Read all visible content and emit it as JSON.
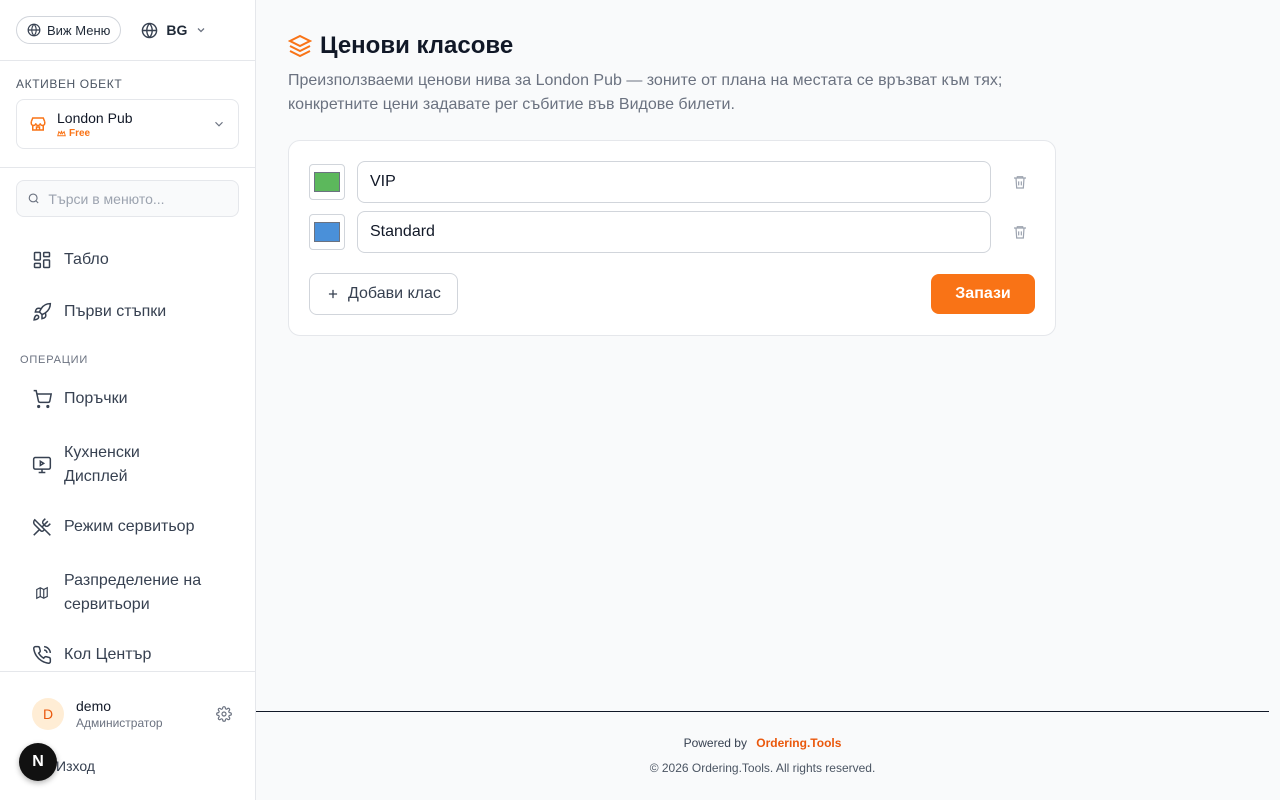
{
  "topbar": {
    "view_menu_label": "Виж Меню",
    "language_code": "BG"
  },
  "venue": {
    "section_label": "АКТИВЕН ОБЕКТ",
    "name": "London Pub",
    "plan": "Free"
  },
  "search": {
    "placeholder": "Търси в менюто..."
  },
  "nav": {
    "items_top": [
      {
        "label": "Табло",
        "icon": "dashboard-icon"
      },
      {
        "label": "Първи стъпки",
        "icon": "rocket-icon"
      }
    ],
    "group_operations": "ОПЕРАЦИИ",
    "items_operations": [
      {
        "label": "Поръчки",
        "icon": "cart-icon"
      },
      {
        "label": "Кухненски Дисплей",
        "icon": "monitor-play-icon"
      },
      {
        "label": "Режим сервитьор",
        "icon": "utensils-crossed-icon"
      },
      {
        "label": "Разпределение на сервитьори",
        "icon": "map-icon"
      },
      {
        "label": "Кол Център",
        "icon": "phone-icon"
      }
    ]
  },
  "user": {
    "initial": "D",
    "name": "demo",
    "role": "Администратор",
    "logout_label": "Изход",
    "dev_badge": "N"
  },
  "page": {
    "title": "Ценови класове",
    "description": "Преизползваеми ценови нива за London Pub — зоните от плана на местата се връзват към тях; конкретните цени задавате per събитие във Видове билети."
  },
  "tiers": [
    {
      "name": "VIP",
      "color": "#5cb85c"
    },
    {
      "name": "Standard",
      "color": "#4a90d9"
    }
  ],
  "actions": {
    "add_label": "Добави клас",
    "save_label": "Запази"
  },
  "footer": {
    "powered_by": "Powered by",
    "brand": "Ordering.Tools",
    "copyright": "© 2026 Ordering.Tools. All rights reserved."
  },
  "colors": {
    "accent": "#f97316"
  }
}
